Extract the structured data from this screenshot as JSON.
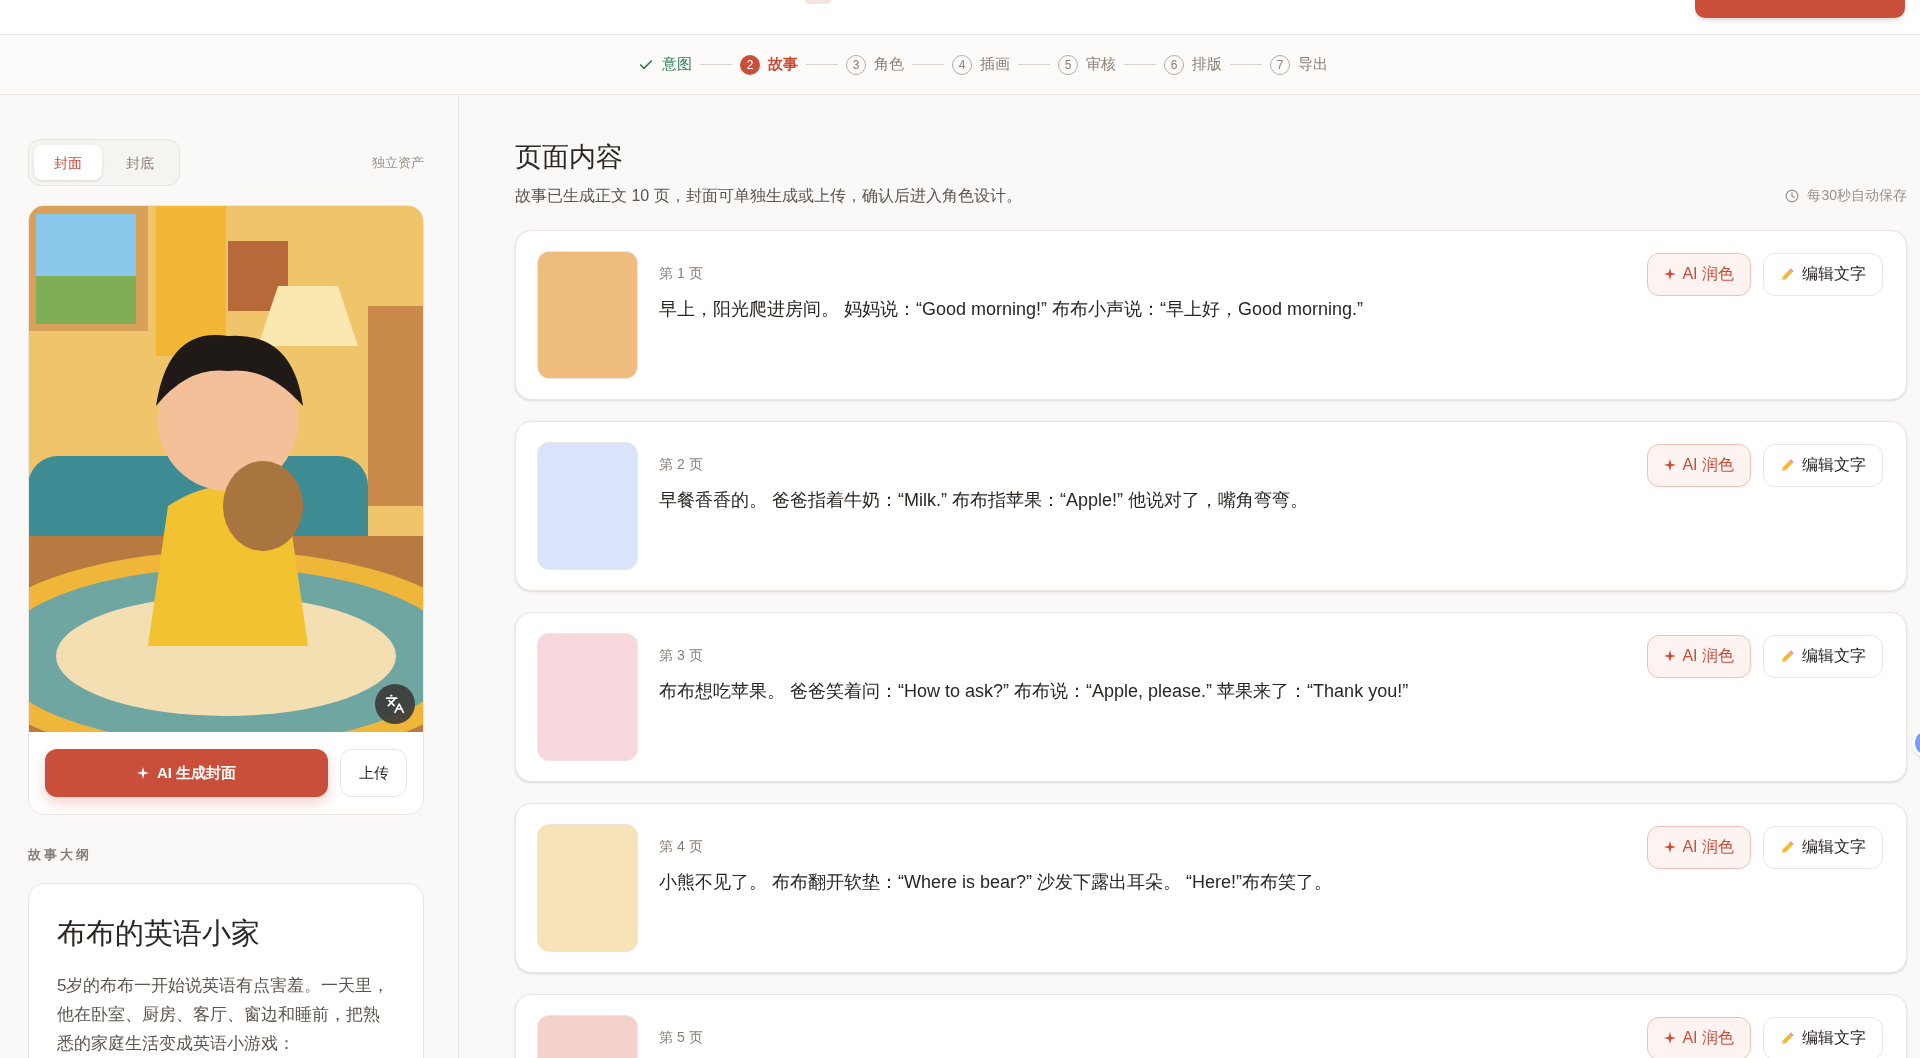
{
  "top_bar": {
    "action_button": {
      "kind": "button"
    }
  },
  "stepper": {
    "steps": [
      {
        "label": "意图",
        "done": true,
        "selected": false
      },
      {
        "number": "2",
        "label": "故事",
        "done": false,
        "selected": true
      },
      {
        "number": "3",
        "label": "角色",
        "done": false,
        "selected": false
      },
      {
        "number": "4",
        "label": "插画",
        "done": false,
        "selected": false
      },
      {
        "number": "5",
        "label": "审核",
        "done": false,
        "selected": false
      },
      {
        "number": "6",
        "label": "排版",
        "done": false,
        "selected": false
      },
      {
        "number": "7",
        "label": "导出",
        "done": false,
        "selected": false
      }
    ]
  },
  "cover_panel": {
    "tabs": [
      {
        "label": "封面",
        "selected": true
      },
      {
        "label": "封底",
        "selected": false
      }
    ],
    "assets_link": "独立资产",
    "generate_button": "AI 生成封面",
    "upload_button": "上传"
  },
  "outline": {
    "heading": "故事大纲",
    "title": "布布的英语小家",
    "summary": "5岁的布布一开始说英语有点害羞。一天里，他在卧室、厨房、客厅、窗边和睡前，把熟悉的家庭生活变成英语小游戏："
  },
  "content": {
    "title": "页面内容",
    "subtitle": "故事已生成正文 10 页，封面可单独生成或上传，确认后进入角色设计。",
    "autosave": "每30秒自动保存",
    "pages": [
      {
        "label": "第 1 页",
        "text": "早上，阳光爬进房间。 妈妈说：“Good morning!” 布布小声说：“早上好，Good morning.”",
        "color": "#eebc7c",
        "polish_button": "AI 润色",
        "edit_button": "编辑文字"
      },
      {
        "label": "第 2 页",
        "text": "早餐香香的。 爸爸指着牛奶：“Milk.” 布布指苹果：“Apple!” 他说对了，嘴角弯弯。",
        "color": "#d9e4fb",
        "polish_button": "AI 润色",
        "edit_button": "编辑文字"
      },
      {
        "label": "第 3 页",
        "text": "布布想吃苹果。 爸爸笑着问：“How to ask?” 布布说：“Apple, please.” 苹果来了：“Thank you!”",
        "color": "#f7d9dd",
        "polish_button": "AI 润色",
        "edit_button": "编辑文字"
      },
      {
        "label": "第 4 页",
        "text": "小熊不见了。 布布翻开软垫：“Where is bear?” 沙发下露出耳朵。 “Here!”布布笑了。",
        "color": "#f8e3b8",
        "polish_button": "AI 润色",
        "edit_button": "编辑文字"
      },
      {
        "label": "第 5 页",
        "color": "#f2d2ca",
        "polish_button": "AI 润色",
        "edit_button": "编辑文字"
      }
    ]
  }
}
